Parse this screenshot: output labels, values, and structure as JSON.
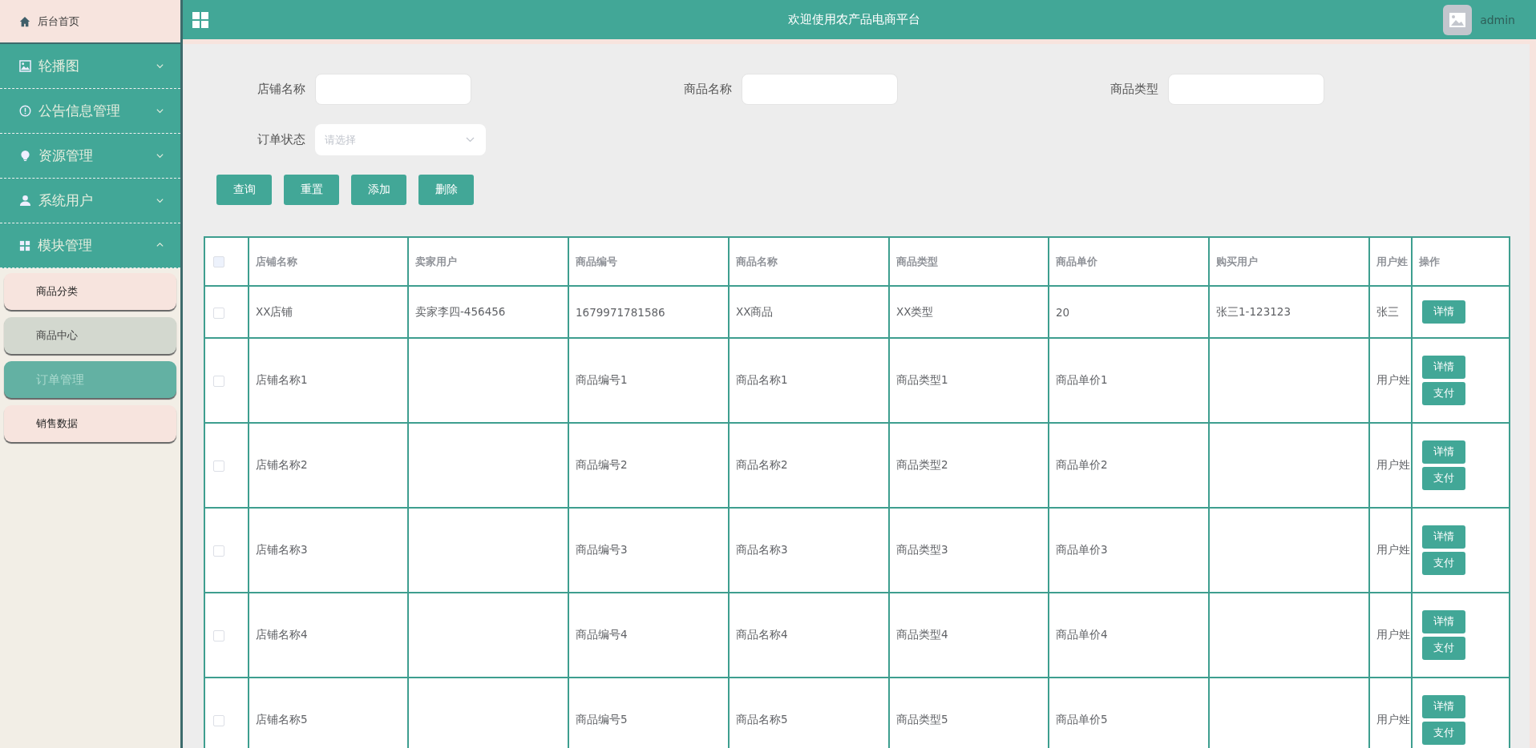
{
  "sidebar": {
    "home": {
      "label": "后台首页"
    },
    "menus": [
      {
        "label": "轮播图",
        "expanded": false
      },
      {
        "label": "公告信息管理",
        "expanded": false
      },
      {
        "label": "资源管理",
        "expanded": false
      },
      {
        "label": "系统用户",
        "expanded": false
      },
      {
        "label": "模块管理",
        "expanded": true,
        "children": [
          {
            "label": "商品分类",
            "selected": false,
            "hovered": false
          },
          {
            "label": "商品中心",
            "selected": false,
            "hovered": true
          },
          {
            "label": "订单管理",
            "selected": true,
            "hovered": false
          },
          {
            "label": "销售数据",
            "selected": false,
            "hovered": false
          }
        ]
      }
    ]
  },
  "header": {
    "title": "欢迎使用农产品电商平台",
    "user": "admin"
  },
  "search": {
    "fields": [
      {
        "kind": "text",
        "label": "店铺名称"
      },
      {
        "kind": "text",
        "label": "商品名称"
      },
      {
        "kind": "text",
        "label": "商品类型"
      },
      {
        "kind": "select",
        "label": "订单状态",
        "placeholder": "请选择"
      }
    ],
    "buttons": [
      "查询",
      "重置",
      "添加",
      "删除"
    ]
  },
  "table": {
    "select_all": {
      "checked": false
    },
    "columns": [
      "店铺名称",
      "卖家用户",
      "商品编号",
      "商品名称",
      "商品类型",
      "商品单价",
      "购买用户",
      "用户姓",
      "操作"
    ],
    "rows": [
      {
        "checked": false,
        "cells": [
          "XX店铺",
          "卖家李四-456456",
          "1679971781586",
          "XX商品",
          "XX类型",
          "20",
          "张三1-123123",
          "张三"
        ],
        "actions": [
          "详情"
        ]
      },
      {
        "checked": false,
        "cells": [
          "店铺名称1",
          "",
          "商品编号1",
          "商品名称1",
          "商品类型1",
          "商品单价1",
          "",
          "用户姓"
        ],
        "actions": [
          "详情",
          "支付"
        ]
      },
      {
        "checked": false,
        "cells": [
          "店铺名称2",
          "",
          "商品编号2",
          "商品名称2",
          "商品类型2",
          "商品单价2",
          "",
          "用户姓"
        ],
        "actions": [
          "详情",
          "支付"
        ]
      },
      {
        "checked": false,
        "cells": [
          "店铺名称3",
          "",
          "商品编号3",
          "商品名称3",
          "商品类型3",
          "商品单价3",
          "",
          "用户姓"
        ],
        "actions": [
          "详情",
          "支付"
        ]
      },
      {
        "checked": false,
        "cells": [
          "店铺名称4",
          "",
          "商品编号4",
          "商品名称4",
          "商品类型4",
          "商品单价4",
          "",
          "用户姓"
        ],
        "actions": [
          "详情",
          "支付"
        ]
      },
      {
        "checked": false,
        "cells": [
          "店铺名称5",
          "",
          "商品编号5",
          "商品名称5",
          "商品类型5",
          "商品单价5",
          "",
          "用户姓"
        ],
        "actions": [
          "详情",
          "支付"
        ]
      }
    ]
  }
}
